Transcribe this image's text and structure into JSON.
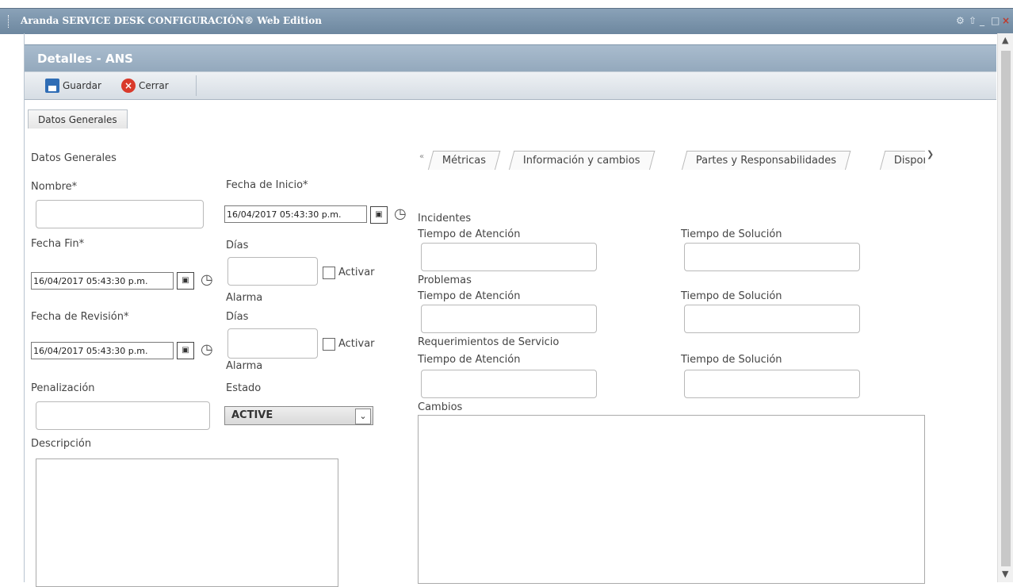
{
  "window": {
    "title": "Aranda SERVICE DESK CONFIGURACIÓN® Web Edition",
    "controls": [
      "⚙",
      "⇧",
      "_",
      "□",
      "×"
    ]
  },
  "header": {
    "title": "Detalles - ANS"
  },
  "toolbar": {
    "save_label": "Guardar",
    "close_label": "Cerrar"
  },
  "main_tab": {
    "label": "Datos Generales"
  },
  "form": {
    "section_title": "Datos Generales",
    "nombre_label": "Nombre*",
    "fecha_inicio_label": "Fecha de Inicio*",
    "fecha_inicio_value": "16/04/2017 05:43:30 p.m.",
    "fecha_fin_label": "Fecha Fin*",
    "fecha_fin_value": "16/04/2017 05:43:30 p.m.",
    "dias_label_1": "Días",
    "activar_label_1": "Activar",
    "alarma_label_1": "Alarma",
    "fecha_revision_label": "Fecha de Revisión*",
    "fecha_revision_value": "16/04/2017 05:43:30 p.m.",
    "dias_label_2": "Días",
    "activar_label_2": "Activar",
    "alarma_label_2": "Alarma",
    "penalizacion_label": "Penalización",
    "estado_label": "Estado",
    "estado_value": "ACTIVE",
    "descripcion_label": "Descripción"
  },
  "subtabs": {
    "items": [
      "Métricas",
      "Información y cambios",
      "Partes y Responsabilidades",
      "Disponi"
    ]
  },
  "metrics": {
    "incidentes_label": "Incidentes",
    "problemas_label": "Problemas",
    "requerimientos_label": "Requerimientos de Servicio",
    "atencion_label": "Tiempo de Atención",
    "solucion_label": "Tiempo de Solución",
    "cambios_label": "Cambios"
  }
}
